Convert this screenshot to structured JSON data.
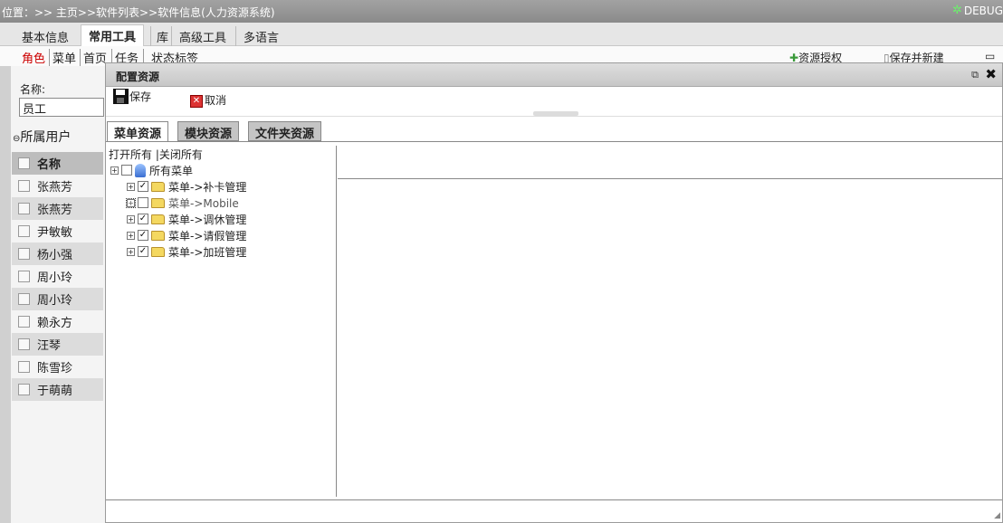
{
  "breadcrumb": "位置：>> 主页>>软件列表>>软件信息(人力资源系统)",
  "debug_label": "DEBUG",
  "main_tabs": [
    {
      "label": "基本信息",
      "active": false
    },
    {
      "label": "常用工具",
      "active": true
    },
    {
      "label": "库",
      "active": false
    },
    {
      "label": "高级工具",
      "active": false
    },
    {
      "label": "多语言",
      "active": false
    }
  ],
  "sub_tabs": [
    {
      "label": "角色",
      "active": true
    },
    {
      "label": "菜单"
    },
    {
      "label": "首页"
    },
    {
      "label": "任务"
    },
    {
      "label": "状态标签"
    }
  ],
  "right_toolbar": {
    "resource_auth": "资源授权",
    "save_new": "保存并新建"
  },
  "role_form": {
    "name_label": "名称:",
    "name_value": "员工"
  },
  "user_group_title": "所属用户",
  "user_table": {
    "header": "名称",
    "rows": [
      "张燕芳",
      "张燕芳",
      "尹敏敏",
      "杨小强",
      "周小玲",
      "周小玲",
      "赖永方",
      "汪琴",
      "陈雪珍",
      "于萌萌"
    ]
  },
  "dialog": {
    "title": "配置资源",
    "save_label": "保存",
    "cancel_label": "取消",
    "tabs": [
      {
        "label": "菜单资源",
        "active": true
      },
      {
        "label": "模块资源",
        "active": false
      },
      {
        "label": "文件夹资源",
        "active": false
      }
    ],
    "tree_actions": {
      "open_all": "打开所有",
      "close_all": "关闭所有"
    },
    "tree_root": "所有菜单",
    "tree_items": [
      {
        "label": "菜单->补卡管理",
        "checked": true
      },
      {
        "label": "菜单->Mobile",
        "checked": false
      },
      {
        "label": "菜单->调休管理",
        "checked": true
      },
      {
        "label": "菜单->请假管理",
        "checked": true
      },
      {
        "label": "菜单->加班管理",
        "checked": true
      }
    ]
  },
  "colors": {
    "active_sub_tab": "#cc0000",
    "topbar": "#999999"
  }
}
